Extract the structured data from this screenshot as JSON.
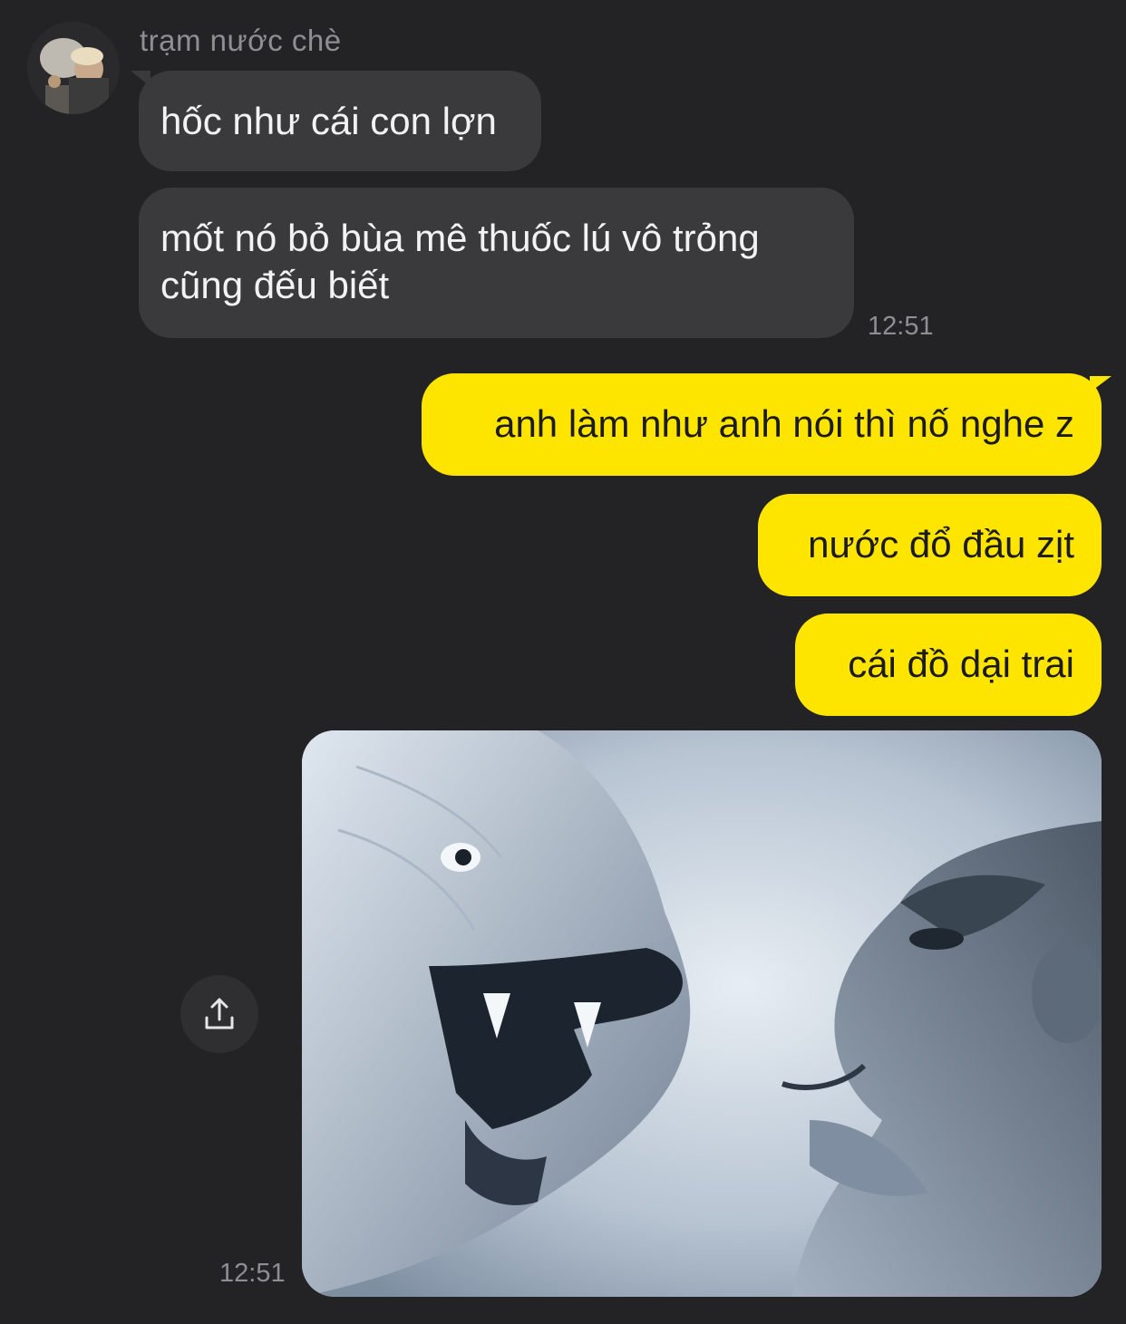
{
  "chat": {
    "sender_name": "trạm nước chè",
    "incoming": [
      "hốc như cái con lợn",
      "mốt nó bỏ bùa mê thuốc lú vô trỏng cũng đếu biết"
    ],
    "incoming_time": "12:51",
    "outgoing": [
      "anh làm như anh nói thì nố nghe z",
      "nước đổ đầu zịt",
      "cái đồ dại trai"
    ],
    "photo_time": "12:51"
  },
  "icons": {
    "share": "share-icon"
  },
  "colors": {
    "background": "#232325",
    "incoming_bubble": "#3a3a3c",
    "outgoing_bubble": "#fee500",
    "secondary_text": "#8e8e93"
  }
}
